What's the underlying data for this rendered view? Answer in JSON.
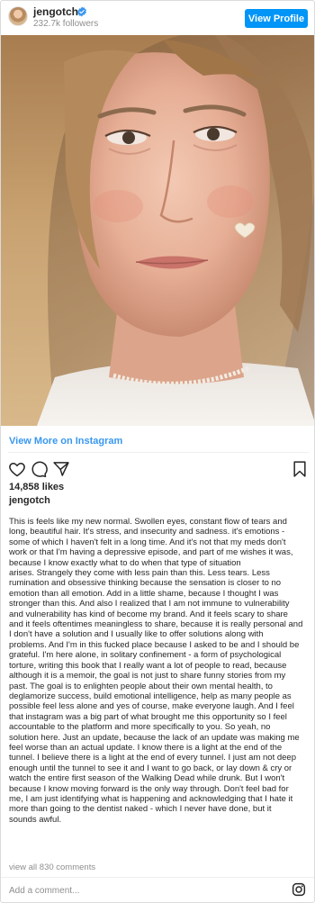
{
  "header": {
    "username": "jengotch",
    "followers": "232.7k followers",
    "view_profile_label": "View Profile"
  },
  "icons": {
    "verified": "verified-badge-icon",
    "like": "heart-icon",
    "comment": "comment-icon",
    "share": "share-icon",
    "save": "bookmark-icon",
    "brand": "instagram-icon"
  },
  "colors": {
    "accent": "#0095f6",
    "link": "#3897f0",
    "muted": "#8e8e8e",
    "text": "#262626"
  },
  "view_more_label": "View More on Instagram",
  "likes": "14,858 likes",
  "caption": {
    "username": "jengotch",
    "lines": [
      "This is feels like my new normal. Swollen eyes, constant flow of tears and",
      "long, beautiful hair. It's stress, and insecurity and sadness.  it's emotions -",
      "some of which I haven't felt in a long time.  And it's not that my meds don't",
      "work or that I'm having a depressive episode, and part of me wishes it was,",
      "because I know exactly what to do when that type of situation",
      "arises.  Strangely they come with less pain than this. Less tears.  Less",
      "rumination and obsessive thinking because the sensation is closer to no",
      "emotion than all emotion.  Add in a little shame, because I thought I was",
      "stronger than this.  And also I realized that I am not immune to vulnerability",
      "and vulnerability has kind of become my brand.  And it feels scary to share",
      "and it feels oftentimes meaningless to share, because it is really personal and",
      "I don't have a solution and I usually like to offer solutions along with",
      "problems. And I'm in this fucked place because I asked to be and I should be",
      "grateful. I'm here alone, in solitary confinement - a form of psychological",
      "torture, writing this book that I really want a lot of people to read, because",
      "although it is a memoir, the goal is not just to share funny stories from my",
      "past. The goal is to enlighten people about their own mental health, to",
      "deglamorize success, build emotional intelligence, help as many people as",
      "possible feel less alone and yes of course, make everyone laugh. And I feel",
      "that instagram was a big part of what brought me this opportunity so I feel",
      "accountable to the platform and more specifically to you. So yeah, no",
      "solution here. Just an update, because the lack of an update was making me",
      "feel worse than an actual update. I know there is a light at the end of the",
      "tunnel.  I believe there is a light at the end of every tunnel. I just am not deep",
      "enough until the tunnel to see it and I want to go back, or lay down & cry or",
      "watch the entire first season of the Walking Dead while drunk.  But I won't",
      "because I know moving forward is the only way through. Don't feel bad for",
      "me, I am just identifying what is happening and acknowledging that I hate it",
      "more than going to the dentist naked - which I never have done, but it",
      "sounds awful."
    ]
  },
  "view_all_comments": "view all 830 comments",
  "comment_placeholder": "Add a comment..."
}
